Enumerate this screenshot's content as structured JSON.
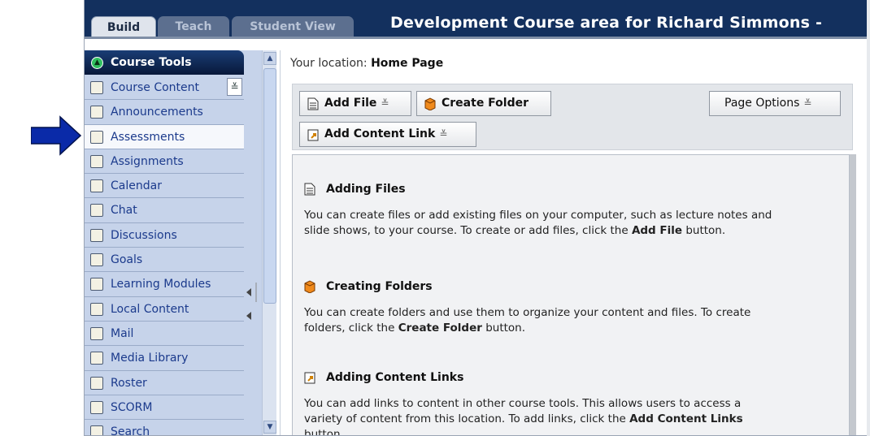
{
  "tabs": [
    {
      "label": "Build",
      "active": true
    },
    {
      "label": "Teach",
      "active": false
    },
    {
      "label": "Student View",
      "active": false
    }
  ],
  "course_title": "Development Course area for Richard Simmons -",
  "sidebar": {
    "header": "Course Tools",
    "content_chevron": "≚",
    "items": [
      {
        "label": "Course Content",
        "icon": "home-icon"
      },
      {
        "label": "Announcements",
        "icon": "megaphone-icon"
      },
      {
        "label": "Assessments",
        "icon": "assessment-icon",
        "selected": true
      },
      {
        "label": "Assignments",
        "icon": "assignment-icon"
      },
      {
        "label": "Calendar",
        "icon": "calendar-icon"
      },
      {
        "label": "Chat",
        "icon": "chat-icon"
      },
      {
        "label": "Discussions",
        "icon": "pin-icon"
      },
      {
        "label": "Goals",
        "icon": "goals-icon"
      },
      {
        "label": "Learning Modules",
        "icon": "module-icon"
      },
      {
        "label": "Local Content",
        "icon": "disc-icon"
      },
      {
        "label": "Mail",
        "icon": "mail-icon"
      },
      {
        "label": "Media Library",
        "icon": "media-icon"
      },
      {
        "label": "Roster",
        "icon": "people-icon"
      },
      {
        "label": "SCORM",
        "icon": "scorm-icon"
      },
      {
        "label": "Search",
        "icon": "search-icon"
      }
    ]
  },
  "location": {
    "prefix": "Your location:",
    "value": "Home Page"
  },
  "toolbar": {
    "add_file": "Add File",
    "create_folder": "Create Folder",
    "page_options": "Page Options",
    "add_content_link": "Add Content Link",
    "caret": "≚"
  },
  "sections": {
    "files": {
      "title": "Adding Files",
      "text": "You can create files or add existing files on your computer, such as lecture notes and slide shows, to your course. To create or add files, click the ",
      "strong": "Add File",
      "tail": " button."
    },
    "folders": {
      "title": "Creating Folders",
      "text": "You can create folders and use them to organize your content and files. To create folders, click the ",
      "strong": "Create Folder",
      "tail": " button."
    },
    "links": {
      "title": "Adding Content Links",
      "text": "You can add links to content in other course tools. This allows users to access a variety of content from this location. To add links, click the ",
      "strong": "Add Content Links",
      "tail": " button."
    }
  },
  "colors": {
    "topbar": "#13305e",
    "sidebar": "#c6d3ea",
    "link": "#1b3a8c",
    "arrow": "#0a2aa8"
  }
}
